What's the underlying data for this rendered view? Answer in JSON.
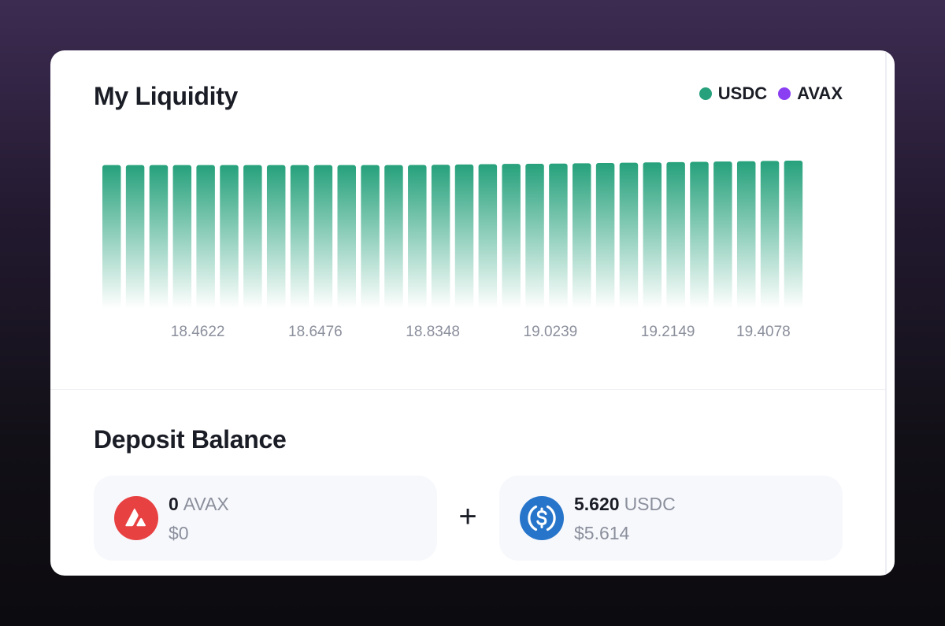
{
  "liquidity": {
    "title": "My Liquidity",
    "legend": [
      {
        "label": "USDC",
        "color": "#26a17b"
      },
      {
        "label": "AVAX",
        "color": "#8a3ff2"
      }
    ]
  },
  "chart_data": {
    "type": "bar",
    "x_tick_labels": [
      "18.4622",
      "18.6476",
      "18.8348",
      "19.0239",
      "19.2149",
      "19.4078"
    ],
    "series": [
      {
        "name": "USDC",
        "color": "#26a17b",
        "values": [
          0.97,
          0.97,
          0.97,
          0.97,
          0.97,
          0.97,
          0.97,
          0.97,
          0.97,
          0.97,
          0.97,
          0.97,
          0.97,
          0.971,
          0.972,
          0.974,
          0.976,
          0.978,
          0.979,
          0.98,
          0.982,
          0.984,
          0.986,
          0.988,
          0.99,
          0.992,
          0.994,
          0.996,
          0.998,
          1.0
        ]
      }
    ],
    "grid": false
  },
  "deposit": {
    "title": "Deposit Balance",
    "separator": "+",
    "tokens": [
      {
        "amount": "0",
        "symbol": "AVAX",
        "usd": "$0",
        "icon": "avax-logo-icon",
        "color": "#e84142"
      },
      {
        "amount": "5.620",
        "symbol": "USDC",
        "usd": "$5.614",
        "icon": "usdc-logo-icon",
        "color": "#2775ca"
      }
    ]
  }
}
